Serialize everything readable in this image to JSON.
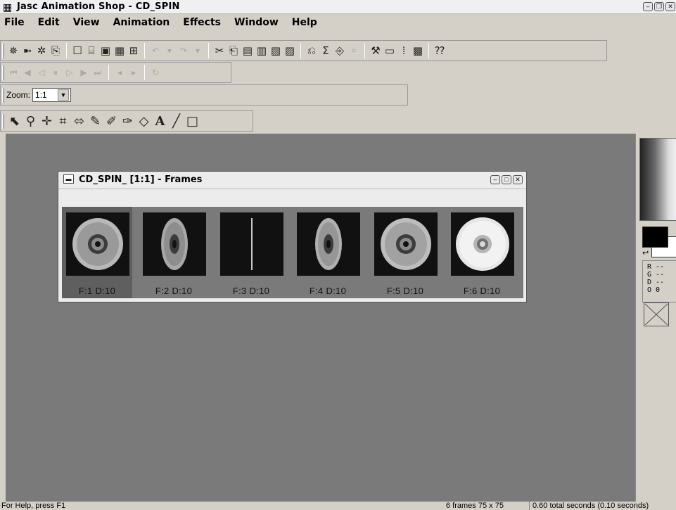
{
  "titlebar": {
    "title": "Jasc Animation Shop - CD_SPIN",
    "app_icon": "app-icon",
    "window_buttons": [
      "minimize",
      "restore",
      "close"
    ]
  },
  "menu": [
    "File",
    "Edit",
    "View",
    "Animation",
    "Effects",
    "Window",
    "Help"
  ],
  "zoom": {
    "label": "Zoom:",
    "value": "1:1"
  },
  "frames_window": {
    "title": "CD_SPIN_ [1:1] - Frames",
    "frames": [
      {
        "label": "F:1  D:10",
        "selected": true,
        "shape": "disc-full"
      },
      {
        "label": "F:2  D:10",
        "selected": false,
        "shape": "disc-narrow"
      },
      {
        "label": "F:3  D:10",
        "selected": false,
        "shape": "disc-edge"
      },
      {
        "label": "F:4  D:10",
        "selected": false,
        "shape": "disc-narrow"
      },
      {
        "label": "F:5  D:10",
        "selected": false,
        "shape": "disc-wide"
      },
      {
        "label": "F:6  D:10",
        "selected": false,
        "shape": "disc-front"
      }
    ]
  },
  "color_panel": {
    "rgb": [
      "R --",
      "G --",
      "D --",
      "O 0"
    ]
  },
  "status": {
    "help": "For Help, press F1",
    "frames": "6 frames   75 x 75",
    "seconds": "0.60 total seconds   (0.10 seconds)"
  },
  "colors": {
    "workspace": "#7a7a7a",
    "chrome": "#d4d0c8",
    "frame_selected": "#5f5f5f"
  }
}
